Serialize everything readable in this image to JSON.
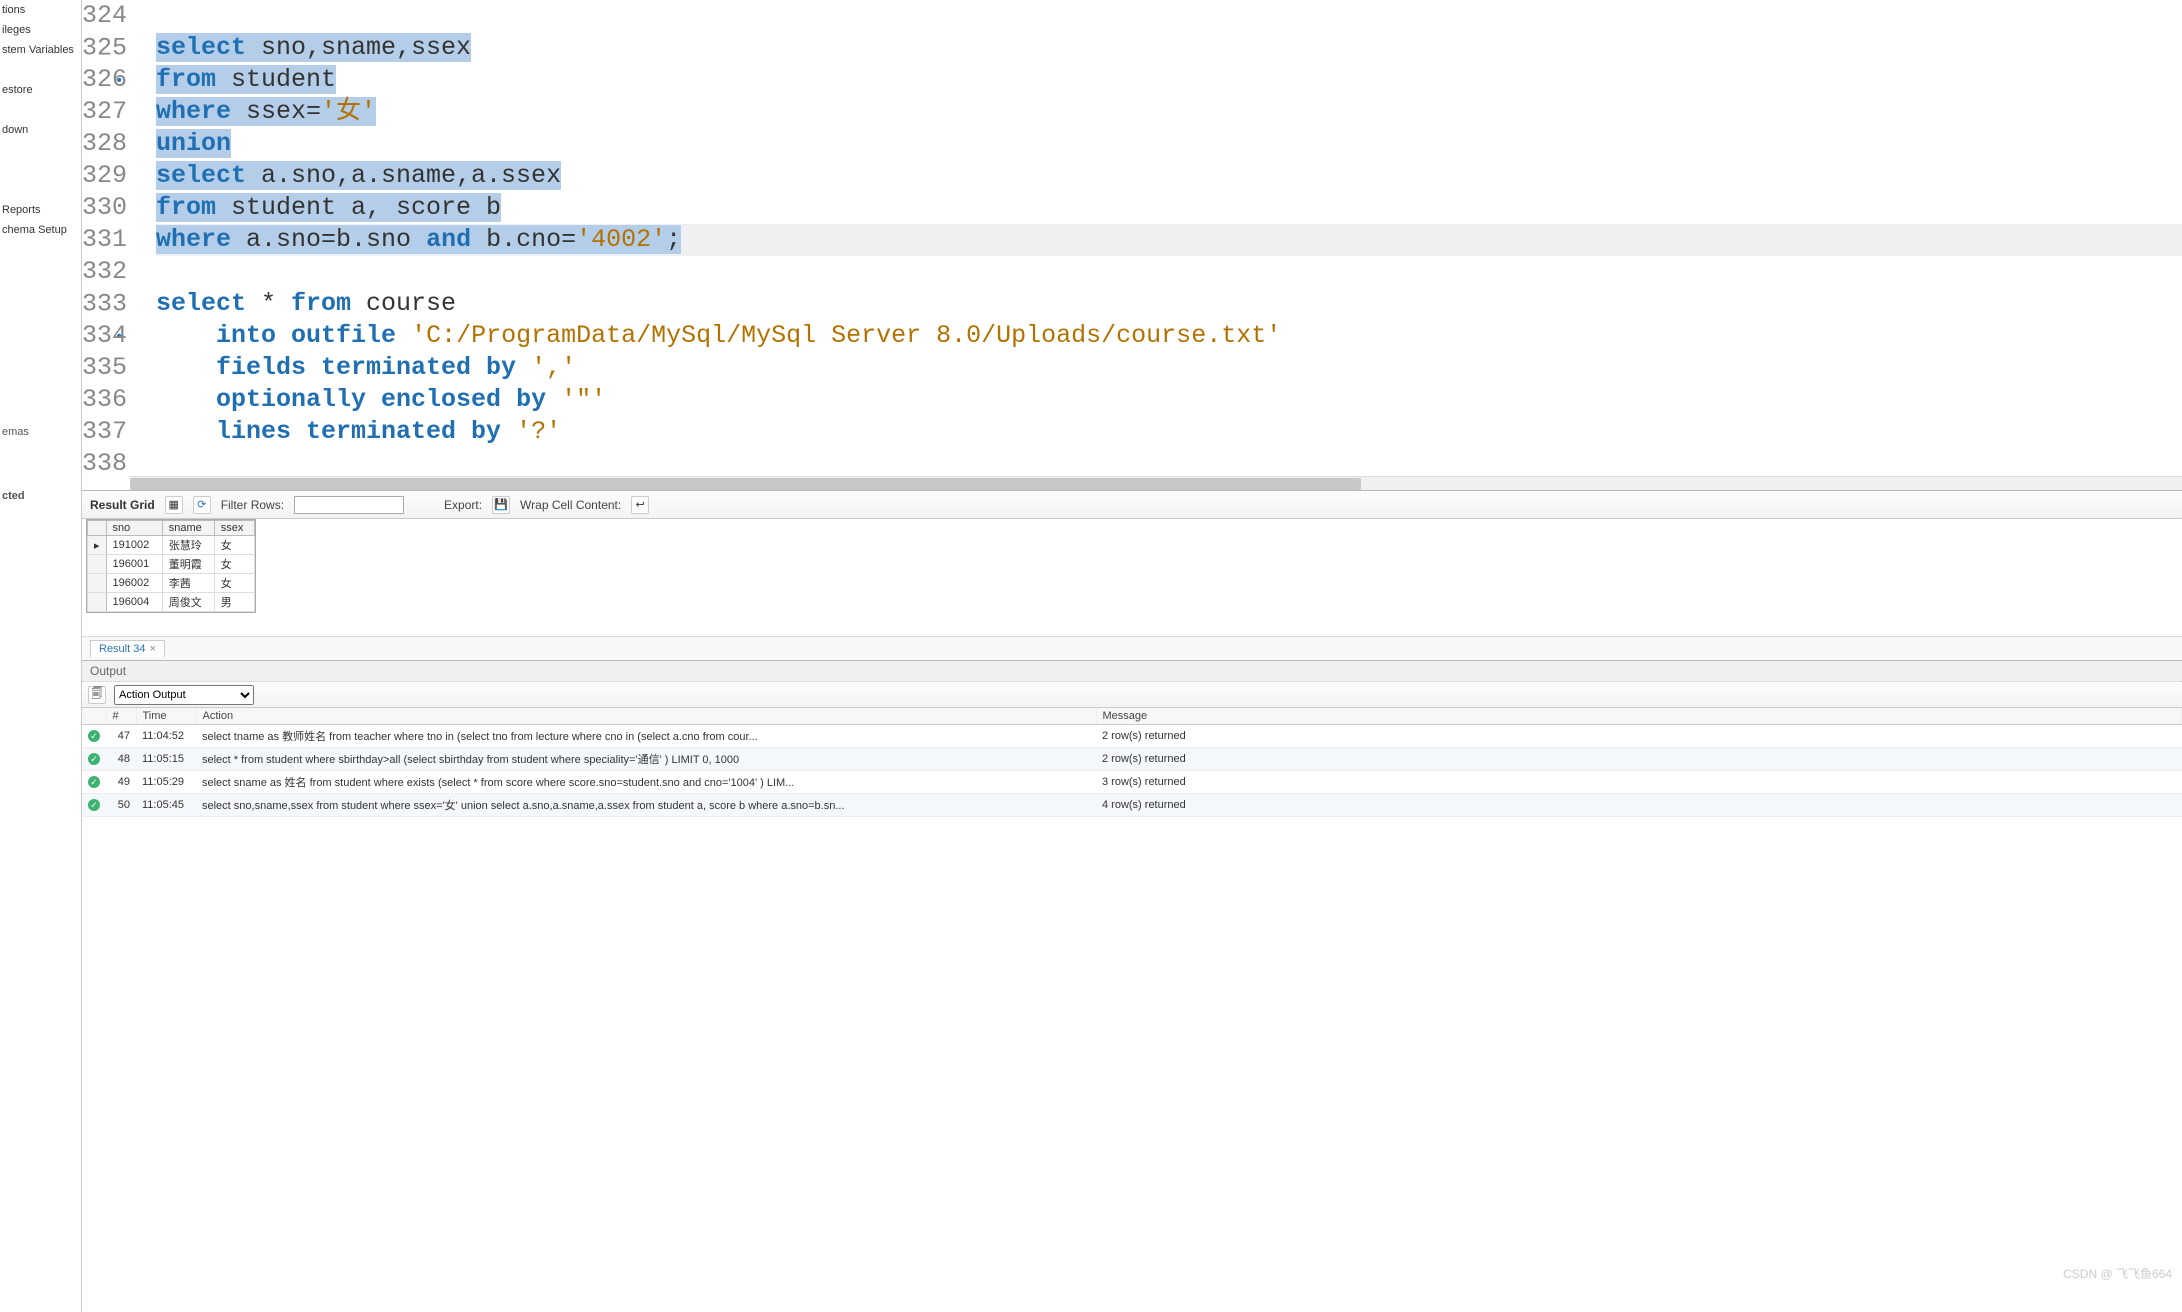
{
  "sidebar": {
    "group1": [
      "tions",
      "ileges",
      "stem Variables"
    ],
    "group2": [
      "estore"
    ],
    "group3": [
      "down"
    ],
    "group4": [
      "Reports",
      "chema Setup"
    ],
    "footer1": "emas",
    "footer2": "cted"
  },
  "editor": {
    "lines": [
      {
        "num": "324",
        "bullet": false,
        "current": false,
        "sel": false,
        "tokens": []
      },
      {
        "num": "325",
        "bullet": true,
        "current": false,
        "sel": true,
        "tokens": [
          [
            "kw",
            "select"
          ],
          [
            "ident",
            " sno,sname,ssex"
          ]
        ]
      },
      {
        "num": "326",
        "bullet": false,
        "current": false,
        "sel": true,
        "tokens": [
          [
            "kw",
            "from"
          ],
          [
            "ident",
            " student"
          ]
        ]
      },
      {
        "num": "327",
        "bullet": false,
        "current": false,
        "sel": true,
        "tokens": [
          [
            "kw",
            "where"
          ],
          [
            "ident",
            " ssex="
          ],
          [
            "str",
            "'女'"
          ]
        ]
      },
      {
        "num": "328",
        "bullet": false,
        "current": false,
        "sel": true,
        "tokens": [
          [
            "kw",
            "union"
          ]
        ]
      },
      {
        "num": "329",
        "bullet": false,
        "current": false,
        "sel": true,
        "tokens": [
          [
            "kw",
            "select"
          ],
          [
            "ident",
            " a.sno,a.sname,a.ssex"
          ]
        ]
      },
      {
        "num": "330",
        "bullet": false,
        "current": false,
        "sel": true,
        "tokens": [
          [
            "kw",
            "from"
          ],
          [
            "ident",
            " student a, score b"
          ]
        ]
      },
      {
        "num": "331",
        "bullet": false,
        "current": true,
        "sel": true,
        "tokens": [
          [
            "kw",
            "where"
          ],
          [
            "ident",
            " a.sno=b.sno "
          ],
          [
            "kw",
            "and"
          ],
          [
            "ident",
            " b.cno="
          ],
          [
            "str",
            "'4002'"
          ],
          [
            "punct",
            ";"
          ]
        ]
      },
      {
        "num": "332",
        "bullet": false,
        "current": false,
        "sel": false,
        "tokens": []
      },
      {
        "num": "333",
        "bullet": true,
        "current": false,
        "sel": false,
        "tokens": [
          [
            "kw",
            "select"
          ],
          [
            "ident",
            " * "
          ],
          [
            "kw",
            "from"
          ],
          [
            "ident",
            " course"
          ]
        ]
      },
      {
        "num": "334",
        "bullet": false,
        "current": false,
        "sel": false,
        "tokens": [
          [
            "ident",
            "    "
          ],
          [
            "kw",
            "into outfile "
          ],
          [
            "str",
            "'C:/ProgramData/MySql/MySql Server 8.0/Uploads/course.txt'"
          ]
        ]
      },
      {
        "num": "335",
        "bullet": false,
        "current": false,
        "sel": false,
        "tokens": [
          [
            "ident",
            "    "
          ],
          [
            "kw",
            "fields terminated by "
          ],
          [
            "str",
            "','"
          ]
        ]
      },
      {
        "num": "336",
        "bullet": false,
        "current": false,
        "sel": false,
        "tokens": [
          [
            "ident",
            "    "
          ],
          [
            "kw",
            "optionally enclosed by "
          ],
          [
            "str",
            "'\"'"
          ]
        ]
      },
      {
        "num": "337",
        "bullet": false,
        "current": false,
        "sel": false,
        "tokens": [
          [
            "ident",
            "    "
          ],
          [
            "kw",
            "lines terminated by "
          ],
          [
            "str",
            "'?'"
          ]
        ]
      },
      {
        "num": "338",
        "bullet": false,
        "current": false,
        "sel": false,
        "tokens": []
      }
    ]
  },
  "results_toolbar": {
    "label": "Result Grid",
    "filter_label": "Filter Rows:",
    "filter_value": "",
    "export_label": "Export:",
    "wrap_label": "Wrap Cell Content:"
  },
  "grid": {
    "columns": [
      "sno",
      "sname",
      "ssex"
    ],
    "rows": [
      {
        "sno": "191002",
        "sname": "张慧玲",
        "ssex": "女"
      },
      {
        "sno": "196001",
        "sname": "董明霞",
        "ssex": "女"
      },
      {
        "sno": "196002",
        "sname": "李茜",
        "ssex": "女"
      },
      {
        "sno": "196004",
        "sname": "周俊文",
        "ssex": "男"
      }
    ]
  },
  "result_tab": "Result 34",
  "output": {
    "header": "Output",
    "select": "Action Output",
    "columns": [
      "",
      "#",
      "Time",
      "Action",
      "Message"
    ],
    "rows": [
      {
        "num": "47",
        "time": "11:04:52",
        "action": "select tname as 教师姓名 from teacher where tno in (select tno     from lecture     where cno in (select a.cno            from cour...",
        "msg": "2 row(s) returned"
      },
      {
        "num": "48",
        "time": "11:05:15",
        "action": "select * from student where sbirthday>all (select sbirthday     from student     where speciality='通信'     ) LIMIT 0, 1000",
        "msg": "2 row(s) returned"
      },
      {
        "num": "49",
        "time": "11:05:29",
        "action": "select sname as 姓名 from student where exists (select *     from score     where score.sno=student.sno and cno='1004'     ) LIM...",
        "msg": "3 row(s) returned"
      },
      {
        "num": "50",
        "time": "11:05:45",
        "action": "select sno,sname,ssex from student where ssex='女' union select a.sno,a.sname,a.ssex from student a, score b where a.sno=b.sn...",
        "msg": "4 row(s) returned"
      }
    ]
  },
  "watermark": "CSDN @ 飞飞鱼664"
}
